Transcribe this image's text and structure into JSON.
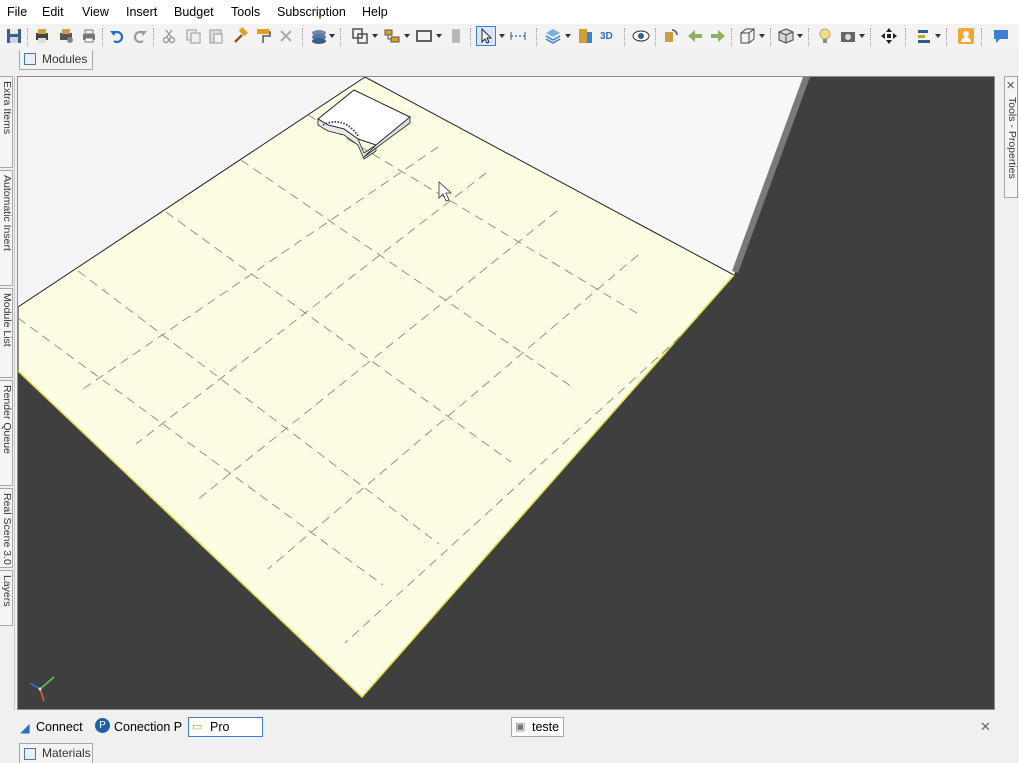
{
  "menu": {
    "items": [
      "File",
      "Edit",
      "View",
      "Insert",
      "Budget",
      "Tools",
      "Subscription",
      "Help"
    ]
  },
  "toolbar": {
    "icons": [
      "save-icon",
      "print-preview-icon",
      "print-setup-icon",
      "printer-icon",
      "undo-icon",
      "redo-icon",
      "cut-icon",
      "copy-icon",
      "paste-icon",
      "hammer-icon",
      "paint-roller-icon",
      "delete-icon",
      "layers-icon",
      "duplicate-icon",
      "group-icon",
      "rectangle-icon",
      "wall-icon",
      "select-arrow-icon",
      "measure-icon",
      "stack-icon",
      "render-icon",
      "3d-icon",
      "eye-icon",
      "rotate-icon",
      "arrow-left-icon",
      "arrow-right-icon",
      "box-view-icon",
      "cube-icon",
      "light-bulb-icon",
      "camera-icon",
      "move-icon",
      "align-icon",
      "user-icon",
      "chat-icon"
    ],
    "label_3d": "3D"
  },
  "tabs": {
    "modules": "Modules",
    "materials": "Materials"
  },
  "left_panel": {
    "tabs": [
      "Extra Items",
      "Automatic Insert",
      "Module List",
      "Render Queue",
      "Real Scene 3.0",
      "Layers"
    ]
  },
  "right_panel": {
    "tab": "Tools - Properties"
  },
  "statusbar": {
    "connect": "Connect",
    "connection": "Conection P",
    "project": "Pro",
    "document": "teste"
  },
  "colors": {
    "floor": "#fdfde4",
    "wall": "#f6f6f6",
    "background": "#3f3f3f",
    "accent": "#3c7fd6"
  }
}
